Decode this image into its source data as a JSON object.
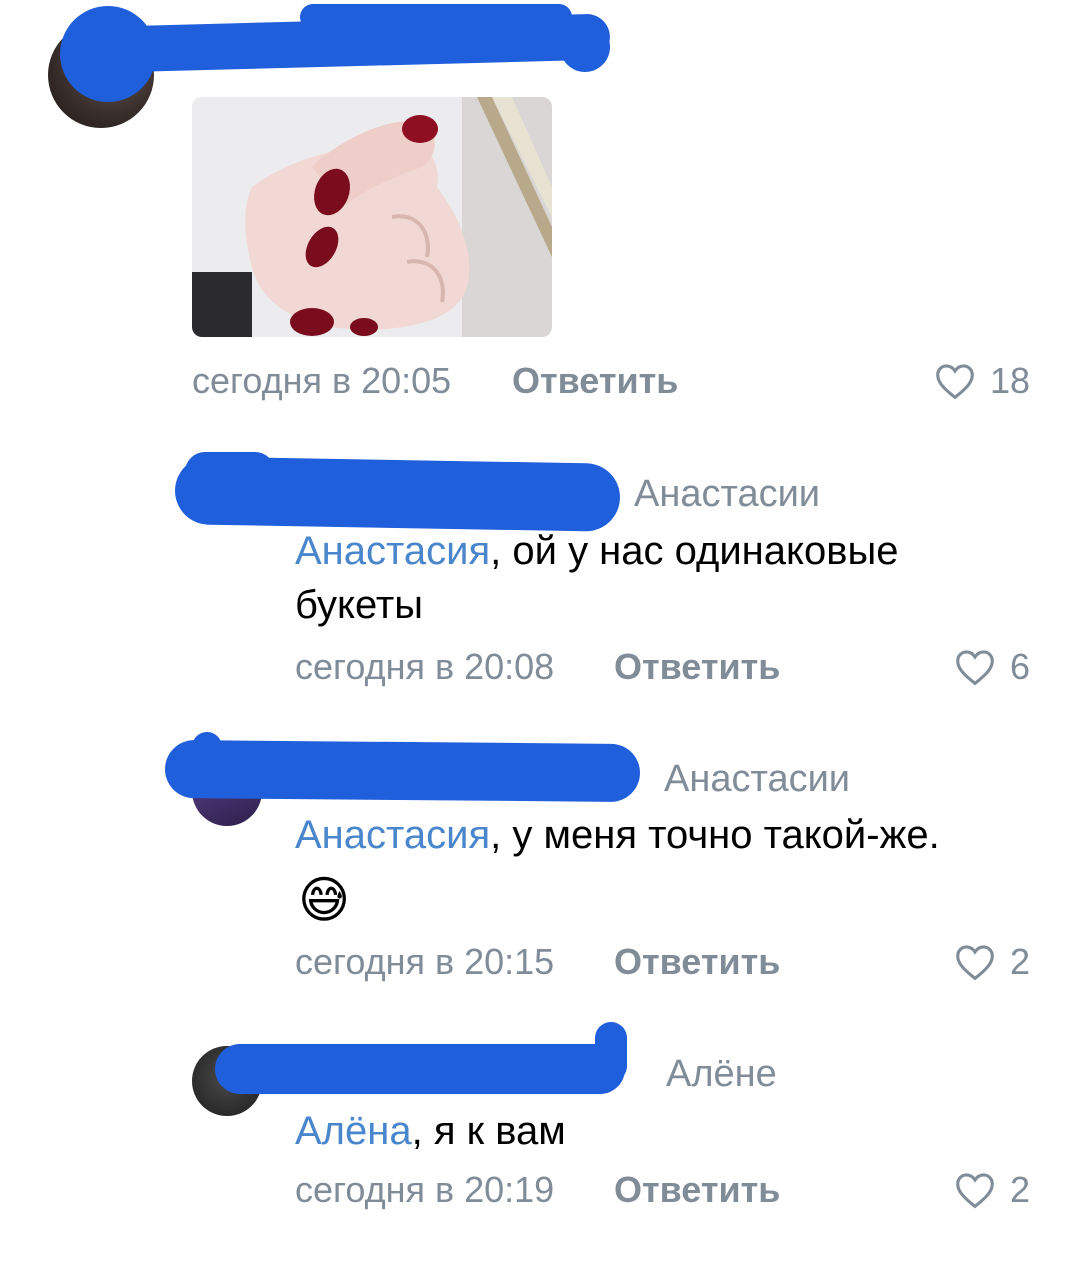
{
  "comments": [
    {
      "time": "сегодня в 20:05",
      "reply_label": "Ответить",
      "likes": "18",
      "has_photo": true
    },
    {
      "addressee": "Анастасии",
      "mention": "Анастасия",
      "text": ", ой у нас одинаковые букеты",
      "time": "сегодня в 20:08",
      "reply_label": "Ответить",
      "likes": "6"
    },
    {
      "addressee": "Анастасии",
      "mention": "Анастасия",
      "text": ", у меня точно такой-же.",
      "emoji": "😅",
      "time": "сегодня в 20:15",
      "reply_label": "Ответить",
      "likes": "2"
    },
    {
      "addressee": "Алёне",
      "mention": "Алёна",
      "text": ", я к вам",
      "time": "сегодня в 20:19",
      "reply_label": "Ответить",
      "likes": "2"
    }
  ],
  "icons": {
    "like": "heart-outline-icon"
  },
  "colors": {
    "mention": "#4986cc",
    "meta": "#818c99",
    "redaction": "#1f5fdb"
  }
}
